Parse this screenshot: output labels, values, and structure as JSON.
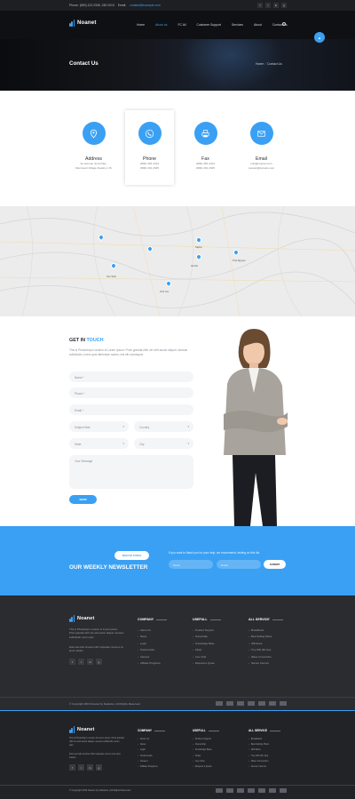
{
  "topbar": {
    "phone": "Phone: (800) 123 2345, 245 2013",
    "email_label": "Email:",
    "email": "contact@example.com",
    "social": [
      "f",
      "t",
      "in",
      "g"
    ]
  },
  "brand": {
    "name": "Noanet"
  },
  "nav": {
    "items": [
      "Home",
      "About",
      "Blog",
      "Contact",
      "Services",
      "Pages",
      "Contact Us"
    ],
    "visible": [
      "Home",
      "About us",
      "FC All",
      "Customer Support",
      "Services",
      "About",
      "Contact Us"
    ],
    "active_index": 1
  },
  "hero": {
    "title": "Contact Us",
    "crumb_home": "Home",
    "crumb_sep": "/",
    "crumb_current": "Contact Us",
    "scroll_icon": "▲"
  },
  "cards": [
    {
      "title": "Address",
      "lines": [
        "4e Avenue de la Paix,",
        "Rammant Village Destiny, US"
      ],
      "icon": "map-pin-icon"
    },
    {
      "title": "Phone",
      "lines": [
        "(800) 345 2413",
        "(800) 234 2345"
      ],
      "icon": "phone-icon"
    },
    {
      "title": "Fax",
      "lines": [
        "(800) 345 2413",
        "(800) 234 2345"
      ],
      "icon": "fax-icon"
    },
    {
      "title": "Email",
      "lines": [
        "info@noanet.com",
        "noanet@domain.com"
      ],
      "icon": "mail-icon"
    }
  ],
  "map": {
    "labels": [
      "Son Tanh",
      "Sapha",
      "Vinh Yen",
      "Thai Nguyen",
      "Ha Noi"
    ]
  },
  "contact_form": {
    "title_a": "GET IN ",
    "title_b": "TOUCH",
    "description": "This is Photoshop's version of Lorem Ipsum. Proin gravida nibh vel velit auctor aliquet. Aenean sollicitudin, lorem quis bibendum auctor, nisi elit consequat.",
    "name_placeholder": "Name *",
    "phone_placeholder": "Phone *",
    "email_placeholder": "Email *",
    "subject_placeholder": "Subject Mail",
    "country_placeholder": "Country",
    "state_placeholder": "State",
    "city_placeholder": "City",
    "message_placeholder": "Your Message",
    "send_label": "SEND"
  },
  "newsletter": {
    "pill_label": "SIGN UP TODAY",
    "title": "OUR WEEKLY NEWSLETTER",
    "text": "If you want to thank you for your help, we recommend, testing on this list.",
    "name_placeholder": "Name",
    "email_placeholder": "Email",
    "submit_label": "SUBMIT"
  },
  "footer": {
    "about": "This is Photoshop's version of Lorem Ipsum. Proin gravida nibh vel velit auctor aliquet. Aenean sollicitudin, lorem quis.",
    "about2": "Duis sed odio sit amet nibh vulputate cursus a sit amet mauris.",
    "columns": [
      {
        "title": "COMPANY",
        "items": [
          "About Us",
          "News",
          "Login",
          "Testimonials",
          "Careers",
          "Affiliate Programs"
        ]
      },
      {
        "title": "USEFULL",
        "items": [
          "Product Support",
          "Ownership",
          "Knowledge Base",
          "FAQs",
          "Live Chat",
          "Request a Quote"
        ]
      },
      {
        "title": "ALL SERVICE",
        "items": [
          "Broadband",
          "Best Selling Plans",
          "Wifi Extra",
          "Tiny Wifi (90 Jan)",
          "Wave Connection",
          "Secure Internet"
        ]
      }
    ],
    "copyright": "© Copyright 2016 Noanet by Nedarine | All Rights Reserved."
  },
  "colors": {
    "accent": "#3aa0f4",
    "dark": "#2b2c30",
    "header": "#0f1013"
  }
}
